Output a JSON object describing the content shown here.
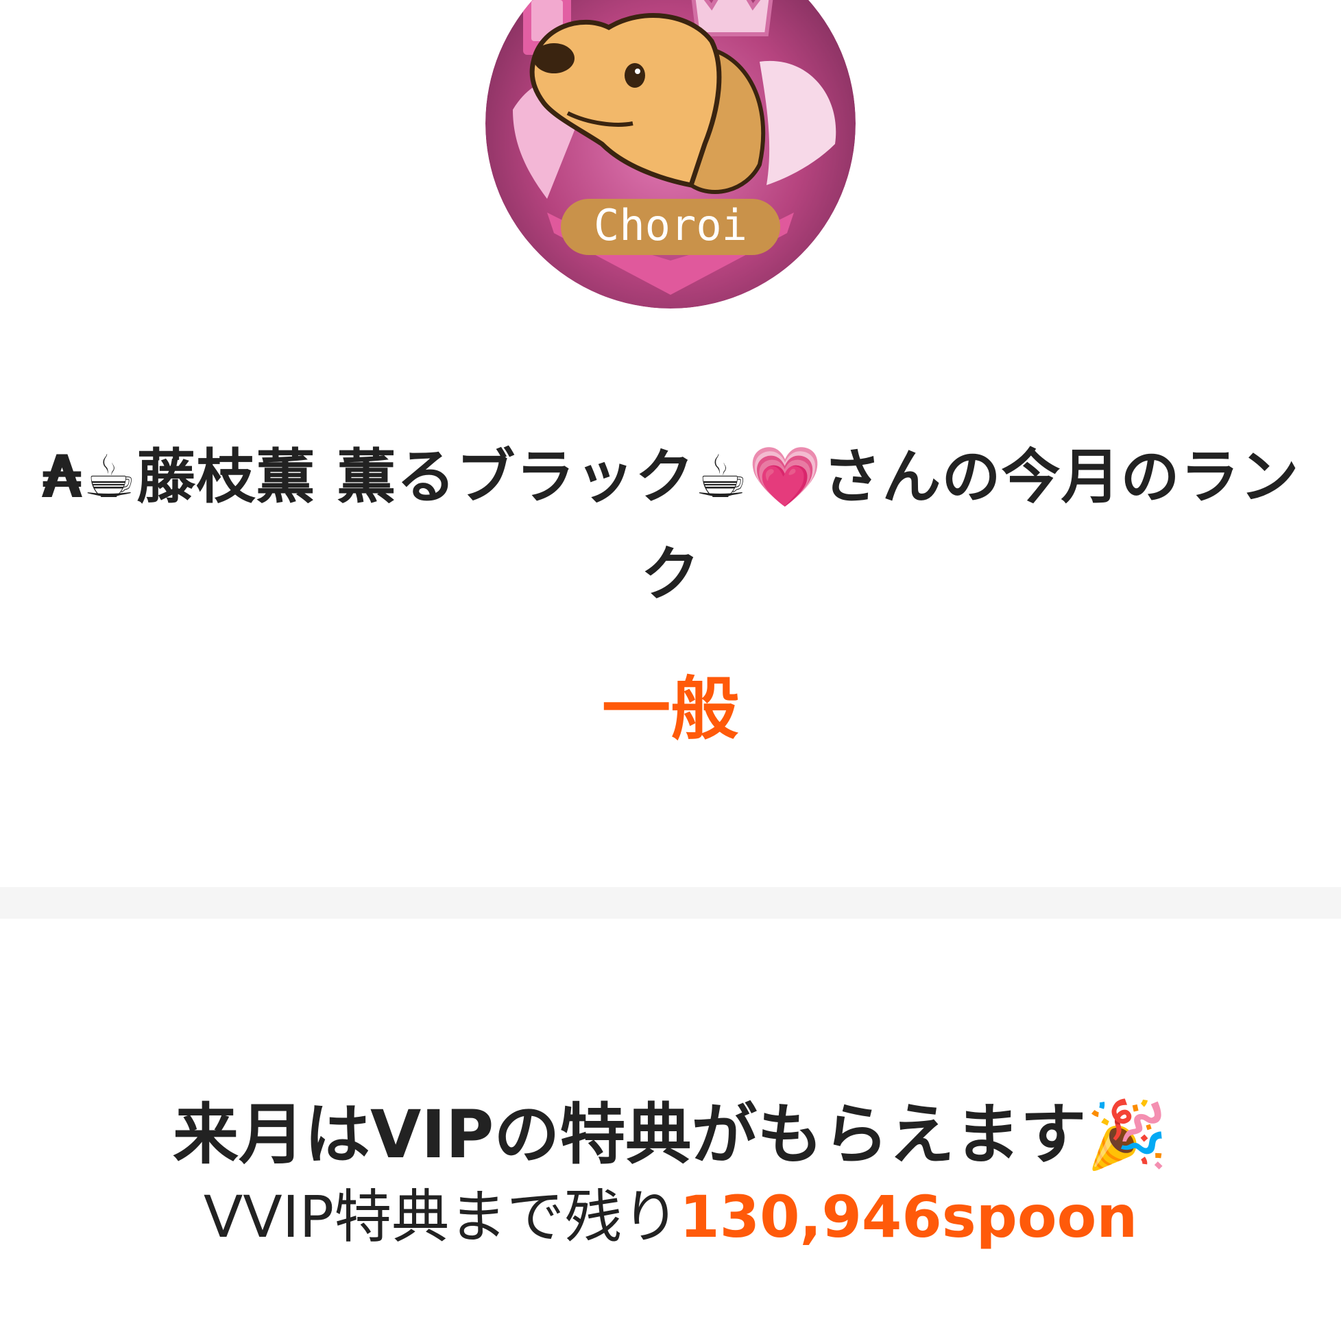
{
  "profile": {
    "avatar_badge_text": "Choroi",
    "avatar_icon": "dog-with-crown-avatar-icon",
    "rank_title": "₳☕藤枝薫 薫るブラック☕💗さんの今月のランク",
    "rank_value": "一般"
  },
  "benefit": {
    "next_month_text": "来月はVIPの特典がもらえます🎉",
    "remaining_prefix": "VVIP特典まで残り",
    "remaining_amount": "130,946spoon"
  },
  "colors": {
    "accent": "#ff5a0a",
    "text": "#222222",
    "divider": "#f5f5f5",
    "avatar_pink": "#c24a8a",
    "badge_gold": "#c9924a"
  }
}
